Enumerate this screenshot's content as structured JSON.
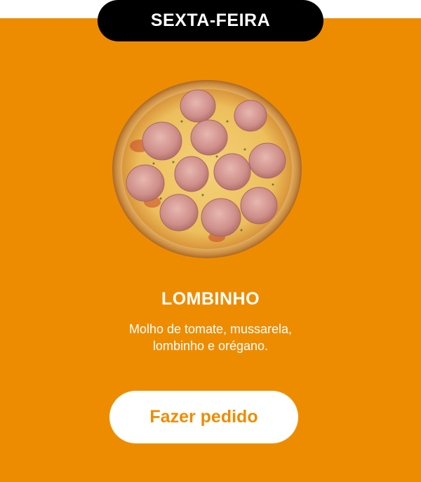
{
  "header": {
    "day_label": "SEXTA-FEIRA"
  },
  "product": {
    "name": "LOMBINHO",
    "description_lines": [
      "Molho de tomate, mussarela,",
      "lombinho e orégano."
    ],
    "image_alt": "pizza-lombinho"
  },
  "actions": {
    "order_label": "Fazer pedido"
  },
  "colors": {
    "accent": "#EE8C00",
    "pill": "#000000",
    "text": "#ffffff"
  }
}
